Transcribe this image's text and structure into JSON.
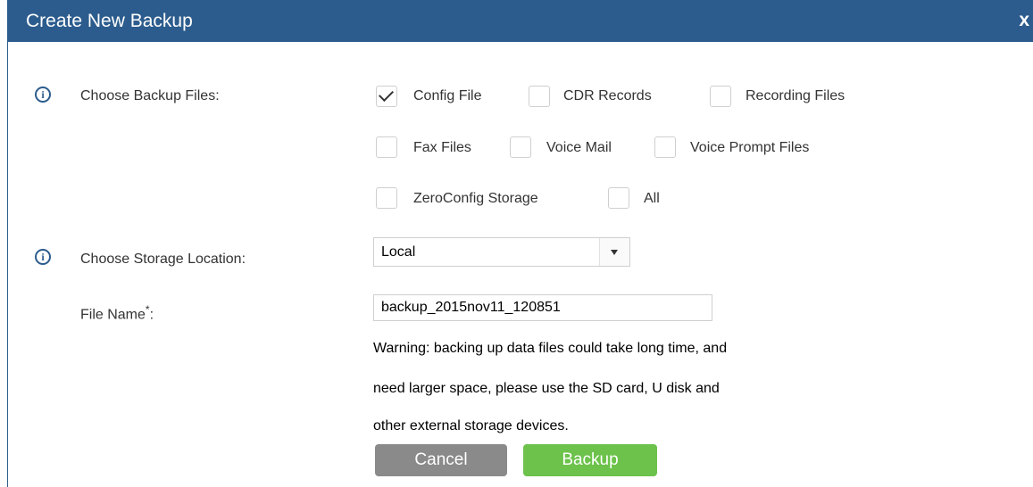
{
  "dialog": {
    "title": "Create New Backup",
    "close_label": "x"
  },
  "backup_files": {
    "label": "Choose Backup Files:",
    "options": [
      {
        "label": "Config File",
        "checked": true
      },
      {
        "label": "CDR Records",
        "checked": false
      },
      {
        "label": "Recording Files",
        "checked": false
      },
      {
        "label": "Fax Files",
        "checked": false
      },
      {
        "label": "Voice Mail",
        "checked": false
      },
      {
        "label": "Voice Prompt Files",
        "checked": false
      },
      {
        "label": "ZeroConfig Storage",
        "checked": false
      },
      {
        "label": "All",
        "checked": false
      }
    ]
  },
  "storage": {
    "label": "Choose Storage Location:",
    "selected": "Local"
  },
  "file_name": {
    "label": "File Name",
    "required_mark": "*",
    "colon": ":",
    "value": "backup_2015nov11_120851"
  },
  "warning": {
    "line1": "Warning: backing up data files could take long time, and",
    "line2": "need larger space, please use the SD card, U disk and",
    "line3": "other external storage devices."
  },
  "buttons": {
    "cancel": "Cancel",
    "backup": "Backup"
  },
  "colors": {
    "titlebar": "#2c5c8d",
    "cancel": "#8a8a8a",
    "backup": "#6cc24a"
  }
}
